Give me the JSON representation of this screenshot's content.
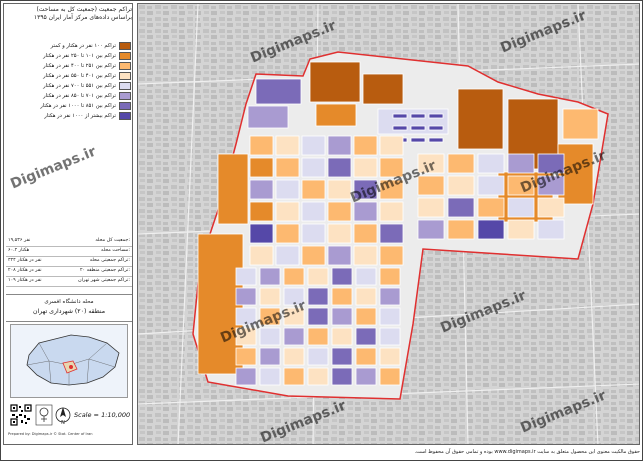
{
  "panel": {
    "title_line1": "تراکم جمعیت (جمعیت کل به مساحت)",
    "title_line2": "براساس داده‌های مرکز آمار ایران ۱۳۹۵"
  },
  "legend": [
    {
      "label": "تراکم ۱۰۰ نفر در هکتار و کمتر",
      "color": "#b85c0f"
    },
    {
      "label": "تراکم بین ۱۰۱ تا ۲۵۰ نفر در هکتار",
      "color": "#e58a2a"
    },
    {
      "label": "تراکم بین ۲۵۱ تا ۴۰۰ نفر در هکتار",
      "color": "#fdb970"
    },
    {
      "label": "تراکم بین ۴۰۱ تا ۵۵۰ نفر در هکتار",
      "color": "#fde2c2"
    },
    {
      "label": "تراکم بین ۵۵۱ تا ۷۰۰ نفر در هکتار",
      "color": "#dcdcf0"
    },
    {
      "label": "تراکم بین ۷۰۱ تا ۸۵۰ نفر در هکتار",
      "color": "#a99bd1"
    },
    {
      "label": "تراکم بین ۸۵۱ تا ۱۰۰۰ نفر در هکتار",
      "color": "#7b6bb8"
    },
    {
      "label": "تراکم بیشتر از ۱۰۰۰ نفر در هکتار",
      "color": "#5548a8"
    }
  ],
  "stats": [
    {
      "label": "جمعیت کل محله:",
      "value": "۱۹,۵۳۶ نفر"
    },
    {
      "label": "مساحت محله:",
      "value": "۶۰.۲ هکتار"
    },
    {
      "label": "تراکم جمعیتی محله:",
      "value": "۳۲۴ نفر در هکتار"
    },
    {
      "label": "تراکم جمعیتی منطقه ۲۰:",
      "value": "۲۰۸ نفر در هکتار"
    },
    {
      "label": "تراکم جمعیتی شهر تهران:",
      "value": "۱۰۹ نفر در هکتار"
    }
  ],
  "area": {
    "line1": "محله دانشگاه افسری",
    "line2": "منطقه (۲۰) شهرداری تهران"
  },
  "footer": {
    "scale": "Scale = 1:10,000",
    "credit": "Prepared by: Digimaps.ir   ©   Stat. Center of Iran"
  },
  "map": {
    "watermark": "Digimaps.ir",
    "bottom_note": "حقوق مالکیت معنوی این محصول متعلق به سایت www.digimaps.ir بوده و تمامی حقوق آن محفوظ است."
  },
  "colors": {
    "map_bg": "#d6d6d6",
    "boundary": "#e03030"
  }
}
